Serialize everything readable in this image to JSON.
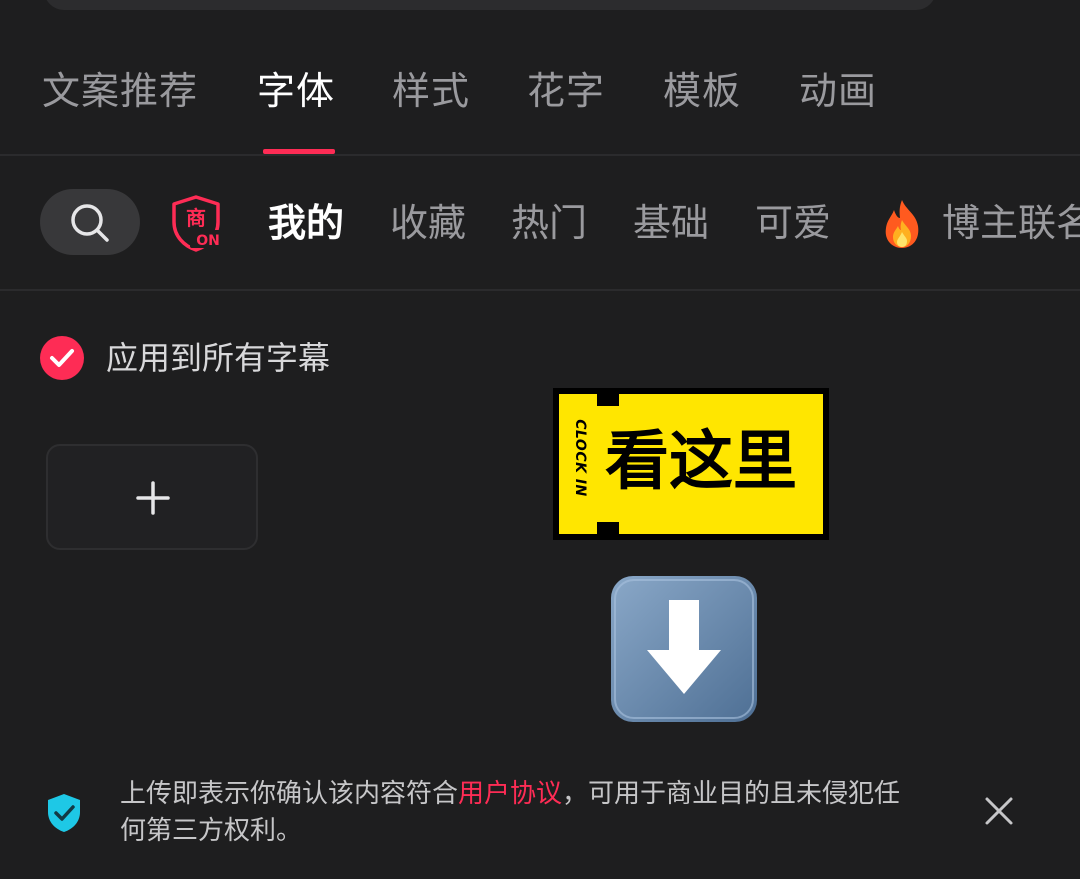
{
  "main_tabs": [
    {
      "label": "文案推荐",
      "active": false
    },
    {
      "label": "字体",
      "active": true
    },
    {
      "label": "样式",
      "active": false
    },
    {
      "label": "花字",
      "active": false
    },
    {
      "label": "模板",
      "active": false
    },
    {
      "label": "动画",
      "active": false
    }
  ],
  "categories": {
    "commercial_badge": {
      "line1": "商",
      "line2": "ON"
    },
    "items": [
      "我的",
      "收藏",
      "热门",
      "基础",
      "可爱",
      "博主联名"
    ],
    "active_index": 0
  },
  "apply_all": {
    "label": "应用到所有字幕",
    "checked": true
  },
  "sticker": {
    "side_text": "CLOCK IN",
    "main_text": "看这里"
  },
  "footer": {
    "text_before": "上传即表示你确认该内容符合",
    "link": "用户协议",
    "text_after": "，可用于商业目的且未侵犯任何第三方权利。"
  },
  "icons": {
    "search": "search-icon",
    "shield": "shield-check-icon",
    "close": "close-icon",
    "add": "plus-icon",
    "fire": "fire-icon",
    "arrow": "arrow-down-icon"
  },
  "colors": {
    "background": "#1e1e1f",
    "accent": "#fe2c55",
    "sticker_yellow": "#ffe600",
    "shield": "#1ec8e6"
  }
}
